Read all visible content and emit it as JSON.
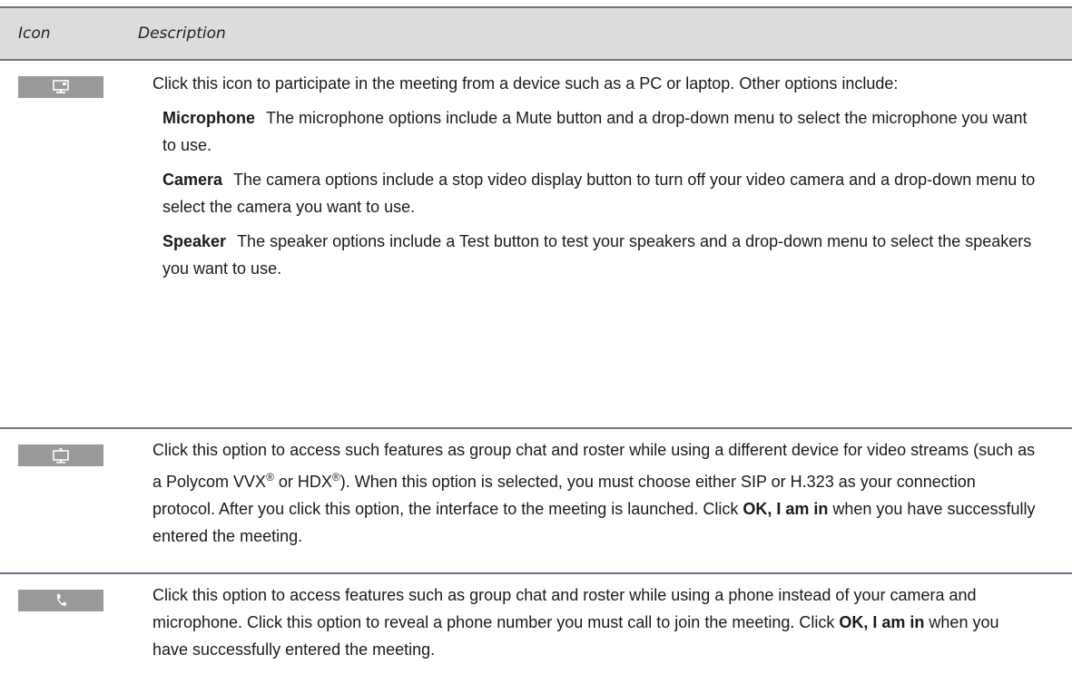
{
  "table": {
    "header": {
      "icon": "Icon",
      "description": "Description"
    },
    "rows": [
      {
        "icon": "monitor-icon",
        "text": "Click this icon to participate in the meeting from a device such as a PC or laptop. Other options include:",
        "options": [
          {
            "term": "Microphone",
            "text": "The microphone options include a Mute button and a drop-down menu to select the microphone you want to use."
          },
          {
            "term": "Camera",
            "text": "The camera options include a stop video display button to turn off your video camera and a drop-down menu to select the camera you want to use."
          },
          {
            "term": "Speaker",
            "text": "The speaker options include a Test button to test your speakers and a drop-down menu to select the speakers you want to use."
          }
        ]
      },
      {
        "icon": "shared-display-icon",
        "text_a": "Click this option to access such features as group chat and roster while using a different device for video streams (such as a Polycom VVX",
        "reg1": "®",
        "text_b": " or HDX",
        "reg2": "®",
        "text_c": "). When this option is selected, you must choose either SIP or H.323 as your connection protocol. After you click this option, the interface to the meeting is launched. Click ",
        "bold": "OK, I am in",
        "text_d": " when you have successfully entered the meeting."
      },
      {
        "icon": "phone-icon",
        "text_a": "Click this option to access features such as group chat and roster while using a phone instead of your camera and microphone. Click this option to reveal a phone number you must call to join the meeting. Click ",
        "bold": "OK, I am in",
        "text_b": " when you have successfully entered the meeting."
      }
    ],
    "colors": {
      "rule": "#6b7685",
      "header_bg": "#dcdcdc",
      "icon_bg": "#9a9a9a"
    }
  }
}
